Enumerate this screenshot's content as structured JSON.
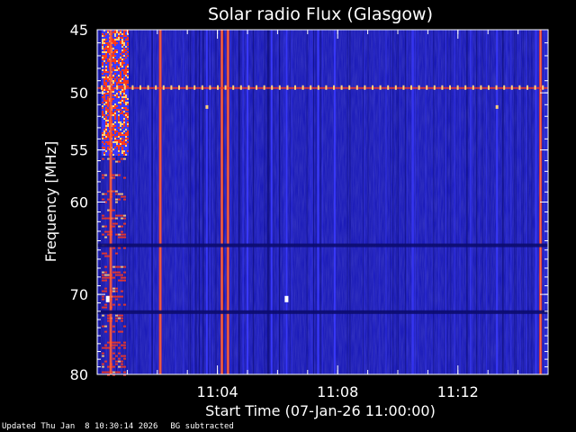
{
  "chart_data": {
    "type": "heatmap",
    "title": "Solar radio Flux (Glasgow)",
    "xlabel": "Start Time (07-Jan-26 11:00:00)",
    "ylabel": "Frequency [MHz]",
    "x_unit": "minutes after 11:00:00",
    "xlim": [
      0,
      15
    ],
    "ylim": [
      80,
      45
    ],
    "y_scale": "log",
    "x_ticks": [
      {
        "value": 4,
        "label": "11:04"
      },
      {
        "value": 8,
        "label": "11:08"
      },
      {
        "value": 12,
        "label": "11:12"
      }
    ],
    "y_ticks": [
      {
        "value": 45,
        "label": "45"
      },
      {
        "value": 50,
        "label": "50"
      },
      {
        "value": 55,
        "label": "55"
      },
      {
        "value": 60,
        "label": "60"
      },
      {
        "value": 70,
        "label": "70"
      },
      {
        "value": 80,
        "label": "80"
      }
    ],
    "colors": {
      "background": "#1a1ab8",
      "low": "#0c0c6e",
      "mid": "#3a3aff",
      "high": "#ff3a1a",
      "peak": "#ffd27a",
      "axis": "#ffffff"
    },
    "interference_line_mhz": 49.6,
    "dark_bands_mhz": [
      64.5,
      72.1
    ],
    "vertical_emission_streaks": [
      {
        "time_min": 0.45,
        "intensity": "high",
        "fmin": 45,
        "fmax": 80
      },
      {
        "time_min": 2.1,
        "intensity": "high",
        "fmin": 45,
        "fmax": 80
      },
      {
        "time_min": 3.65,
        "intensity": "medium",
        "fmin": 45,
        "fmax": 80
      },
      {
        "time_min": 4.15,
        "intensity": "high",
        "fmin": 45,
        "fmax": 80
      },
      {
        "time_min": 4.35,
        "intensity": "high",
        "fmin": 45,
        "fmax": 80
      },
      {
        "time_min": 5.0,
        "intensity": "medium",
        "fmin": 45,
        "fmax": 80
      },
      {
        "time_min": 5.8,
        "intensity": "medium",
        "fmin": 45,
        "fmax": 80
      },
      {
        "time_min": 6.3,
        "intensity": "medium",
        "fmin": 45,
        "fmax": 80
      },
      {
        "time_min": 7.35,
        "intensity": "medium",
        "fmin": 45,
        "fmax": 80
      },
      {
        "time_min": 7.9,
        "intensity": "medium",
        "fmin": 45,
        "fmax": 80
      },
      {
        "time_min": 11.6,
        "intensity": "low",
        "fmin": 45,
        "fmax": 80
      },
      {
        "time_min": 13.3,
        "intensity": "medium",
        "fmin": 45,
        "fmax": 80
      },
      {
        "time_min": 14.6,
        "intensity": "medium",
        "fmin": 45,
        "fmax": 80
      },
      {
        "time_min": 14.75,
        "intensity": "high",
        "fmin": 45,
        "fmax": 80
      }
    ],
    "early_burst": {
      "t_start": 0.15,
      "t_end": 1.0,
      "fmin": 45,
      "fmax": 55.5
    }
  },
  "footer": {
    "updated": "Updated Thu Jan  8 10:30:14 2026",
    "note": "BG subtracted"
  }
}
